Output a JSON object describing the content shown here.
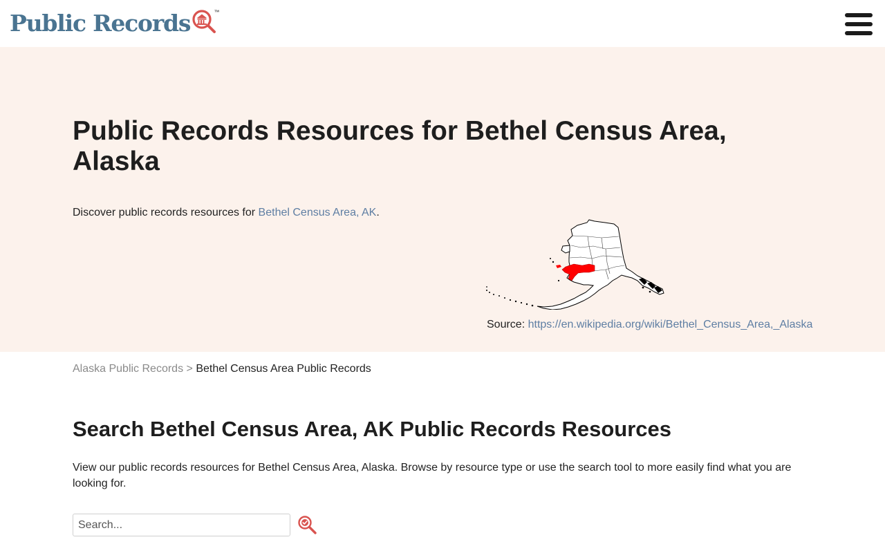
{
  "header": {
    "logo_text": "Public Records",
    "logo_tm": "™",
    "logo_icon": "courthouse-magnifier-icon",
    "menu_icon": "hamburger-menu-icon",
    "accent_color": "#d9534f",
    "brand_color": "#4a7491"
  },
  "hero": {
    "title": "Public Records Resources for Bethel Census Area, Alaska",
    "intro_prefix": "Discover public records resources for ",
    "intro_link": "Bethel Census Area, AK",
    "intro_suffix": ".",
    "map_icon": "alaska-county-map",
    "source_label": "Source: ",
    "source_link": "https://en.wikipedia.org/wiki/Bethel_Census_Area,_Alaska",
    "background_color": "#fcf2ec"
  },
  "breadcrumb": {
    "parent": "Alaska Public Records",
    "separator": ">",
    "current": "Bethel Census Area Public Records"
  },
  "search": {
    "title": "Search Bethel Census Area, AK Public Records Resources",
    "description": "View our public records resources for Bethel Census Area, Alaska. Browse by resource type or use the search tool to more easily find what you are looking for.",
    "placeholder": "Search...",
    "button_icon": "search-check-icon"
  }
}
